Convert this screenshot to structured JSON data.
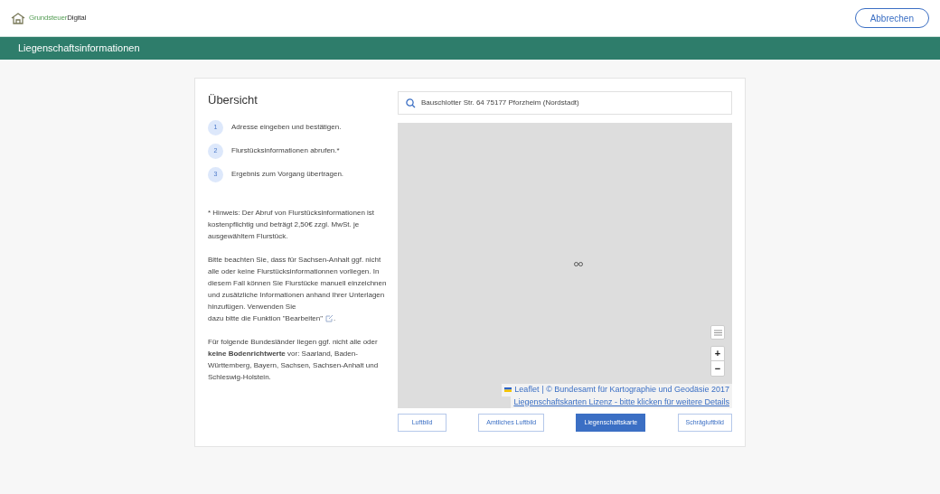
{
  "header": {
    "logo_light": "Grundsteuer",
    "logo_dark": "Digital",
    "cancel_button": "Abbrechen"
  },
  "banner": {
    "title": "Liegenschaftsinformationen"
  },
  "overview": {
    "title": "Übersicht",
    "steps": [
      {
        "number": "1",
        "text": "Adresse eingeben und bestätigen."
      },
      {
        "number": "2",
        "text": "Flurstücksinformationen abrufen.*"
      },
      {
        "number": "3",
        "text": "Ergebnis zum Vorgang übertragen."
      }
    ],
    "note": "* Hinweis: Der Abruf von Flurstücksinformationen ist kostenpflichtig und beträgt 2,50€ zzgl. MwSt. je ausgewähltem Flurstück.",
    "saxony_note": "Bitte beachten Sie, dass für Sachsen-Anhalt ggf. nicht alle oder keine Flurstücksinformationnen vorliegen. In diesem Fall können Sie Flurstücke manuell einzeichnen und zusätzliche Informationen anhand Ihrer Unterlagen hinzufügen. Verwenden Sie",
    "saxony_note_last": "dazu bitte die Funktion \"Bearbeiten\"",
    "saxony_note_end": ".",
    "states_note": "Für folgende Bundesländer liegen ggf. nicht alle oder **keine Bodenrichtwerte** vor: Saarland, Baden-Württemberg, Bayern, Sachsen, Sachsen-Anhalt und Schleswig-Holstein."
  },
  "map": {
    "search_value": "Bauschlotter Str. 64 75177 Pforzheim (Nordstadt)",
    "zoom_in": "+",
    "zoom_out": "−",
    "attribution_link": "Leaflet",
    "attribution": "| © Bundesamt für Kartographie und Geodäsie 2017",
    "license_link": "Liegenschaftskarten Lizenz - bitte klicken für weitere Details",
    "layers": [
      {
        "label": "Luftbild",
        "selected": false
      },
      {
        "label": "Amtliches Luftbild",
        "selected": false
      },
      {
        "label": "Liegenschaftskarte",
        "selected": true
      },
      {
        "label": "Schrägluftbild",
        "selected": false
      }
    ]
  }
}
